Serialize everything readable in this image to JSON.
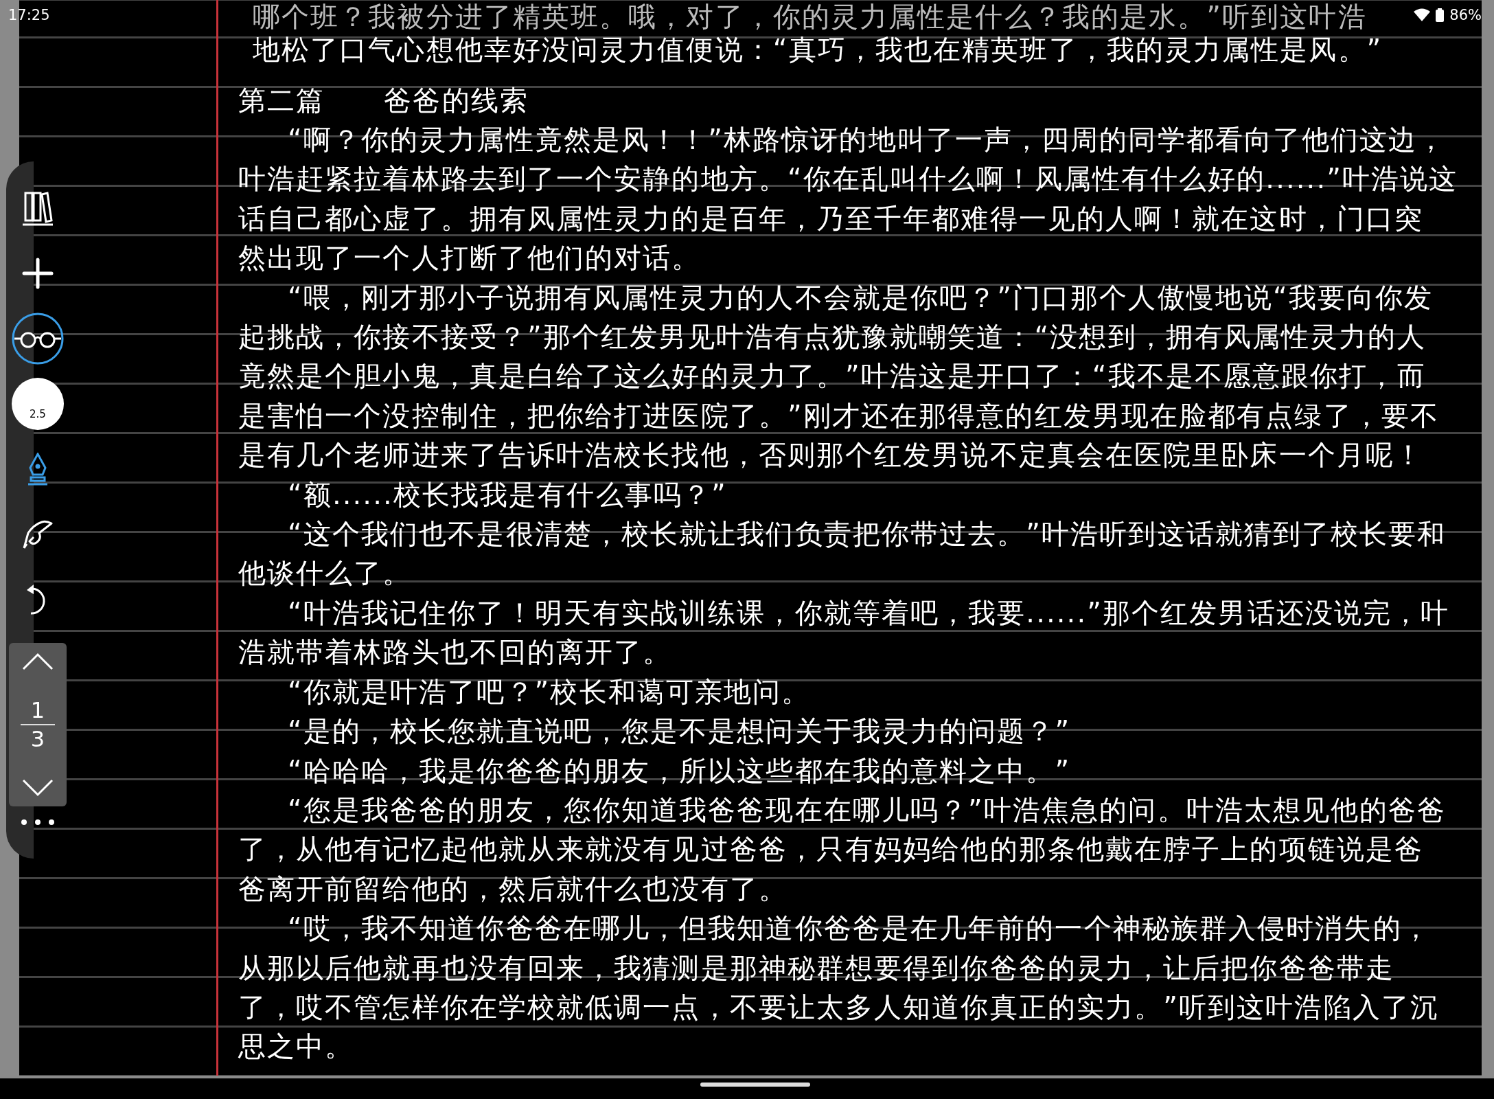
{
  "status_bar": {
    "time": "17:25",
    "battery": "86%"
  },
  "toolbar": {
    "tools": [
      {
        "kind": "library"
      },
      {
        "kind": "add"
      },
      {
        "kind": "reading",
        "selected": true
      },
      {
        "kind": "brush_size",
        "label": "2.5"
      },
      {
        "kind": "pen",
        "selected": true
      },
      {
        "kind": "hand"
      },
      {
        "kind": "undo"
      }
    ],
    "pager": {
      "current": "1",
      "total": "3"
    }
  },
  "page": {
    "fragment": {
      "lines": [
        "哪个班？我被分进了精英班。哦，对了，你的灵力属性是什么？我的是水。”听到这叶浩",
        "地松了口气心想他幸好没问灵力值便说：“真巧，我也在精英班了，我的灵力属性是风。”"
      ]
    },
    "heading": {
      "chapter": "第二篇",
      "title": "爸爸的线索"
    },
    "paragraphs": [
      {
        "lines": [
          "“啊？你的灵力属性竟然是风！！”林路惊讶的地叫了一声，四周的同学都看向了他们这边，",
          "叶浩赶紧拉着林路去到了一个安静的地方。“你在乱叫什么啊！风属性有什么好的......”叶浩说这",
          "话自己都心虚了。拥有风属性灵力的是百年，乃至千年都难得一见的人啊！就在这时，门口突",
          "然出现了一个人打断了他们的对话。"
        ]
      },
      {
        "lines": [
          "“喂，刚才那小子说拥有风属性灵力的人不会就是你吧？”门口那个人傲慢地说“我要向你发",
          "起挑战，你接不接受？”那个红发男见叶浩有点犹豫就嘲笑道：“没想到，拥有风属性灵力的人",
          "竟然是个胆小鬼，真是白给了这么好的灵力了。”叶浩这是开口了：“我不是不愿意跟你打，而",
          "是害怕一个没控制住，把你给打进医院了。”刚才还在那得意的红发男现在脸都有点绿了，要不",
          "是有几个老师进来了告诉叶浩校长找他，否则那个红发男说不定真会在医院里卧床一个月呢！"
        ]
      },
      {
        "lines": [
          "“额......校长找我是有什么事吗？”"
        ]
      },
      {
        "lines": [
          "“这个我们也不是很清楚，校长就让我们负责把你带过去。”叶浩听到这话就猜到了校长要和",
          "他谈什么了。"
        ]
      },
      {
        "lines": [
          "“叶浩我记住你了！明天有实战训练课，你就等着吧，我要......”那个红发男话还没说完，叶",
          "浩就带着林路头也不回的离开了。"
        ]
      },
      {
        "lines": [
          "“你就是叶浩了吧？”校长和蔼可亲地问。"
        ]
      },
      {
        "lines": [
          "“是的，校长您就直说吧，您是不是想问关于我灵力的问题？”"
        ]
      },
      {
        "lines": [
          "“哈哈哈，我是你爸爸的朋友，所以这些都在我的意料之中。”"
        ]
      },
      {
        "lines": [
          "“您是我爸爸的朋友，您你知道我爸爸现在在哪儿吗？”叶浩焦急的问。叶浩太想见他的爸爸",
          "了，从他有记忆起他就从来就没有见过爸爸，只有妈妈给他的那条他戴在脖子上的项链说是爸",
          "爸离开前留给他的，然后就什么也没有了。"
        ]
      },
      {
        "lines": [
          "“哎，我不知道你爸爸在哪儿，但我知道你爸爸是在几年前的一个神秘族群入侵时消失的，",
          "从那以后他就再也没有回来，我猜测是那神秘群想要得到你爸爸的灵力，让后把你爸爸带走",
          "了，哎不管怎样你在学校就低调一点，不要让太多人知道你真正的实力。”听到这叶浩陷入了沉",
          "思之中。"
        ]
      }
    ]
  }
}
